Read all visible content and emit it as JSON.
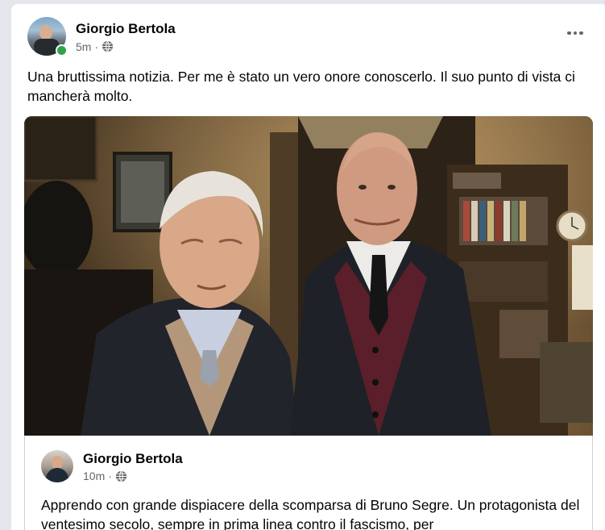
{
  "post": {
    "author": "Giorgio Bertola",
    "time": "5m",
    "separator": "·",
    "privacy_icon": "globe-icon",
    "more_icon": "more-horizontal-icon",
    "text": "Una bruttissima notizia. Per me è stato un vero onore conoscerlo. Il suo punto di vista ci mancherà molto.",
    "online_status_color": "#31a24c"
  },
  "photo": {
    "description_icon": "shared-photo"
  },
  "shared_post": {
    "author": "Giorgio Bertola",
    "time": "10m",
    "separator": "·",
    "privacy_icon": "globe-icon",
    "text": "Apprendo con grande dispiacere della scomparsa di Bruno Segre. Un protagonista del ventesimo secolo, sempre in prima linea contro il fascismo, per"
  },
  "colors": {
    "background": "#e4e6eb",
    "card": "#ffffff",
    "secondary_text": "#65676b",
    "primary_text": "#050505"
  }
}
